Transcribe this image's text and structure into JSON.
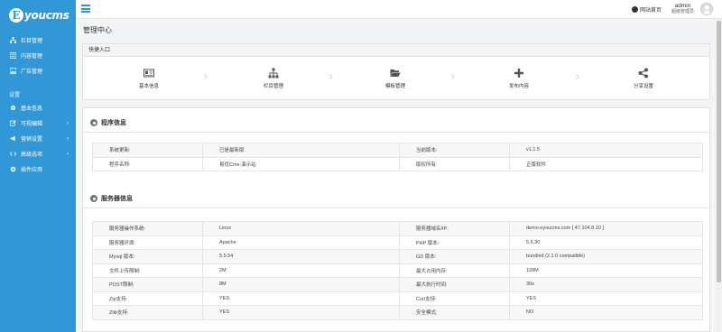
{
  "brand": {
    "mark": "E",
    "text": "youcms"
  },
  "sidebar": {
    "items": [
      {
        "label": "栏目管理",
        "icon": "sitemap-icon"
      },
      {
        "label": "内容管理",
        "icon": "list-icon"
      },
      {
        "label": "广告管理",
        "icon": "image-icon"
      }
    ],
    "section_label": "设置",
    "settings": [
      {
        "label": "基本信息",
        "icon": "gear-icon",
        "chevron": ""
      },
      {
        "label": "可视编辑",
        "icon": "edit-icon",
        "chevron": "›"
      },
      {
        "label": "营销设置",
        "icon": "bullhorn-icon",
        "chevron": "›"
      },
      {
        "label": "高级选项",
        "icon": "code-icon",
        "chevron": "›"
      },
      {
        "label": "插件应用",
        "icon": "puzzle-icon",
        "chevron": ""
      }
    ]
  },
  "header": {
    "site_home": "网站首页",
    "user_name": "admin",
    "user_role": "超级管理员"
  },
  "page_title": "管理中心",
  "quick_entry": {
    "title": "快捷入口",
    "items": [
      {
        "label": "基本信息",
        "icon": "id-card-icon"
      },
      {
        "label": "栏目管理",
        "icon": "sitemap-icon"
      },
      {
        "label": "模板管理",
        "icon": "folder-open-icon"
      },
      {
        "label": "发布内容",
        "icon": "plus-icon"
      },
      {
        "label": "分享设置",
        "icon": "share-icon"
      }
    ],
    "arrow": "›"
  },
  "program_info": {
    "title": "程序信息",
    "rows": [
      [
        "系统更新:",
        "已是最新版",
        "当前版本:",
        "v1.1.5"
      ],
      [
        "程序名称:",
        "易优Cms-演示站",
        "版权所有:",
        "正版软件"
      ]
    ]
  },
  "server_info": {
    "title": "服务器信息",
    "rows": [
      [
        "服务器操作系统:",
        "Linux",
        "服务器域名/IP:",
        "demo.eyoucms.com [ 47.104.8.10 ]"
      ],
      [
        "服务器环境:",
        "Apache",
        "PHP 版本:",
        "5.6.30"
      ],
      [
        "Mysql 版本:",
        "5.5.54",
        "GD 版本:",
        "bundled (2.1.0 compatible)"
      ],
      [
        "文件上传限制:",
        "2M",
        "最大占用内存:",
        "128M"
      ],
      [
        "POST限制:",
        "8M",
        "最大执行时间:",
        "30s"
      ],
      [
        "Zip支持:",
        "YES",
        "Curl支持:",
        "YES"
      ],
      [
        "Zlib支持:",
        "YES",
        "安全模式:",
        "NO"
      ]
    ]
  }
}
